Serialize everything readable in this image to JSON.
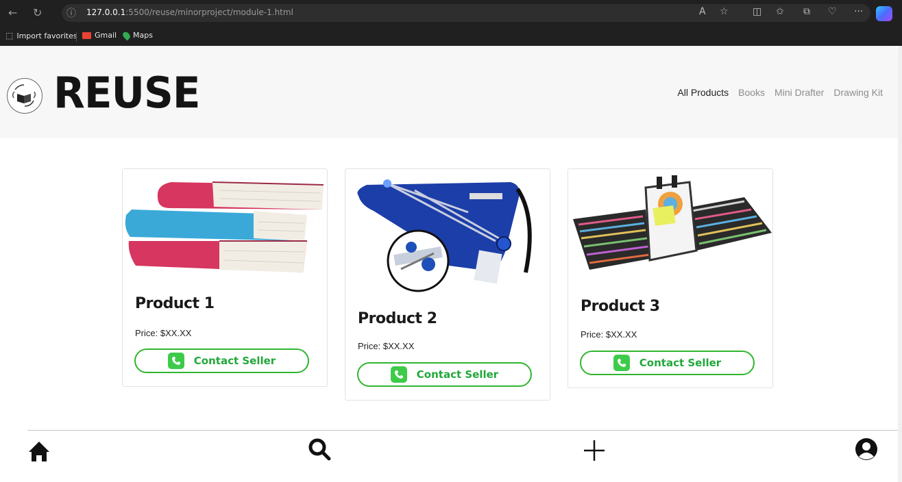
{
  "browser": {
    "url_host": "127.0.0.1",
    "url_path": ":5500/reuse/minorproject/module-1.html",
    "bookmarks": [
      "Import favorites",
      "Gmail",
      "Maps"
    ]
  },
  "header": {
    "brand": "REUSE",
    "nav": [
      "All Products",
      "Books",
      "Mini Drafter",
      "Drawing Kit"
    ],
    "active_nav": "All Products"
  },
  "products": [
    {
      "title": "Product 1",
      "price": "Price: $XX.XX",
      "button": "Contact Seller",
      "image": "books-stack-image"
    },
    {
      "title": "Product 2",
      "price": "Price: $XX.XX",
      "button": "Contact Seller",
      "image": "mini-drafter-image"
    },
    {
      "title": "Product 3",
      "price": "Price: $XX.XX",
      "button": "Contact Seller",
      "image": "drawing-kit-image"
    }
  ],
  "bottom_nav": [
    "home-icon",
    "search-icon",
    "plus-icon",
    "user-icon"
  ],
  "colors": {
    "accent_green": "#2fb52f",
    "header_bg": "#f7f7f7",
    "brand_text": "#141414"
  }
}
